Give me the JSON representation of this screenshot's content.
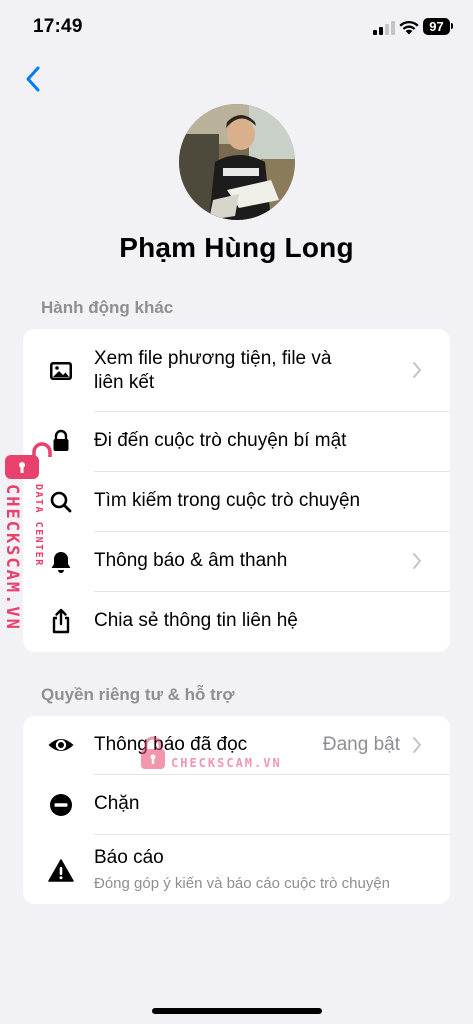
{
  "status_bar": {
    "time": "17:49",
    "battery_level": "97"
  },
  "profile": {
    "name": "Phạm Hùng Long"
  },
  "sections": [
    {
      "header": "Hành động khác",
      "items": [
        {
          "label_line1": "Xem file phương tiện, file và",
          "label_line2": "liên kết",
          "icon": "photo-icon",
          "has_chevron": true
        },
        {
          "label": "Đi đến cuộc trò chuyện bí mật",
          "icon": "lock-icon"
        },
        {
          "label": "Tìm kiếm trong cuộc trò chuyện",
          "icon": "search-icon"
        },
        {
          "label": "Thông báo & âm thanh",
          "icon": "bell-icon",
          "has_chevron": true
        },
        {
          "label": "Chia sẻ thông tin liên hệ",
          "icon": "share-icon"
        }
      ]
    },
    {
      "header": "Quyền riêng tư & hỗ trợ",
      "items": [
        {
          "label": "Thông báo đã đọc",
          "value": "Đang bật",
          "icon": "eye-icon",
          "has_chevron": true
        },
        {
          "label": "Chặn",
          "icon": "block-icon"
        },
        {
          "label": "Báo cáo",
          "subtitle": "Đóng góp ý kiến và báo cáo cuộc trò chuyện",
          "icon": "warning-icon"
        }
      ]
    }
  ],
  "watermark": {
    "vertical_brand": "CHECKSCAM.VN",
    "vertical_tag": "DATA CENTER",
    "center_brand": "CHECKSCAM.VN"
  },
  "colors": {
    "accent": "#007aff",
    "background": "#f2f2f6",
    "secondary_text": "#8e8e93",
    "watermark": "#e8416b"
  }
}
